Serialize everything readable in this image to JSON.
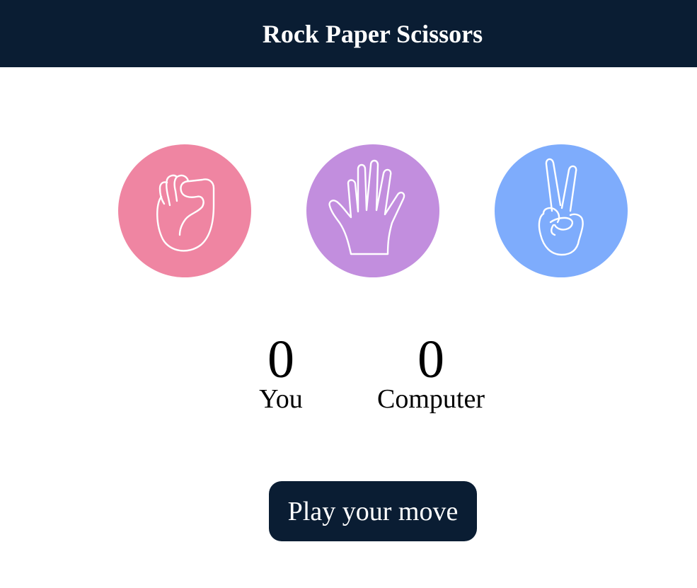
{
  "header": {
    "title": "Rock Paper Scissors"
  },
  "choices": [
    {
      "id": "rock",
      "icon": "fist-icon",
      "color": "#ef85a2"
    },
    {
      "id": "paper",
      "icon": "open-hand-icon",
      "color": "#c28ede"
    },
    {
      "id": "scissors",
      "icon": "peace-hand-icon",
      "color": "#7eacfc"
    }
  ],
  "scoreboard": {
    "you_score": "0",
    "you_label": "You",
    "computer_score": "0",
    "computer_label": "Computer"
  },
  "actions": {
    "play_label": "Play your move"
  },
  "colors": {
    "header_bg": "#0a1d33",
    "button_bg": "#0a1d33",
    "icon_stroke": "#ffffff"
  }
}
